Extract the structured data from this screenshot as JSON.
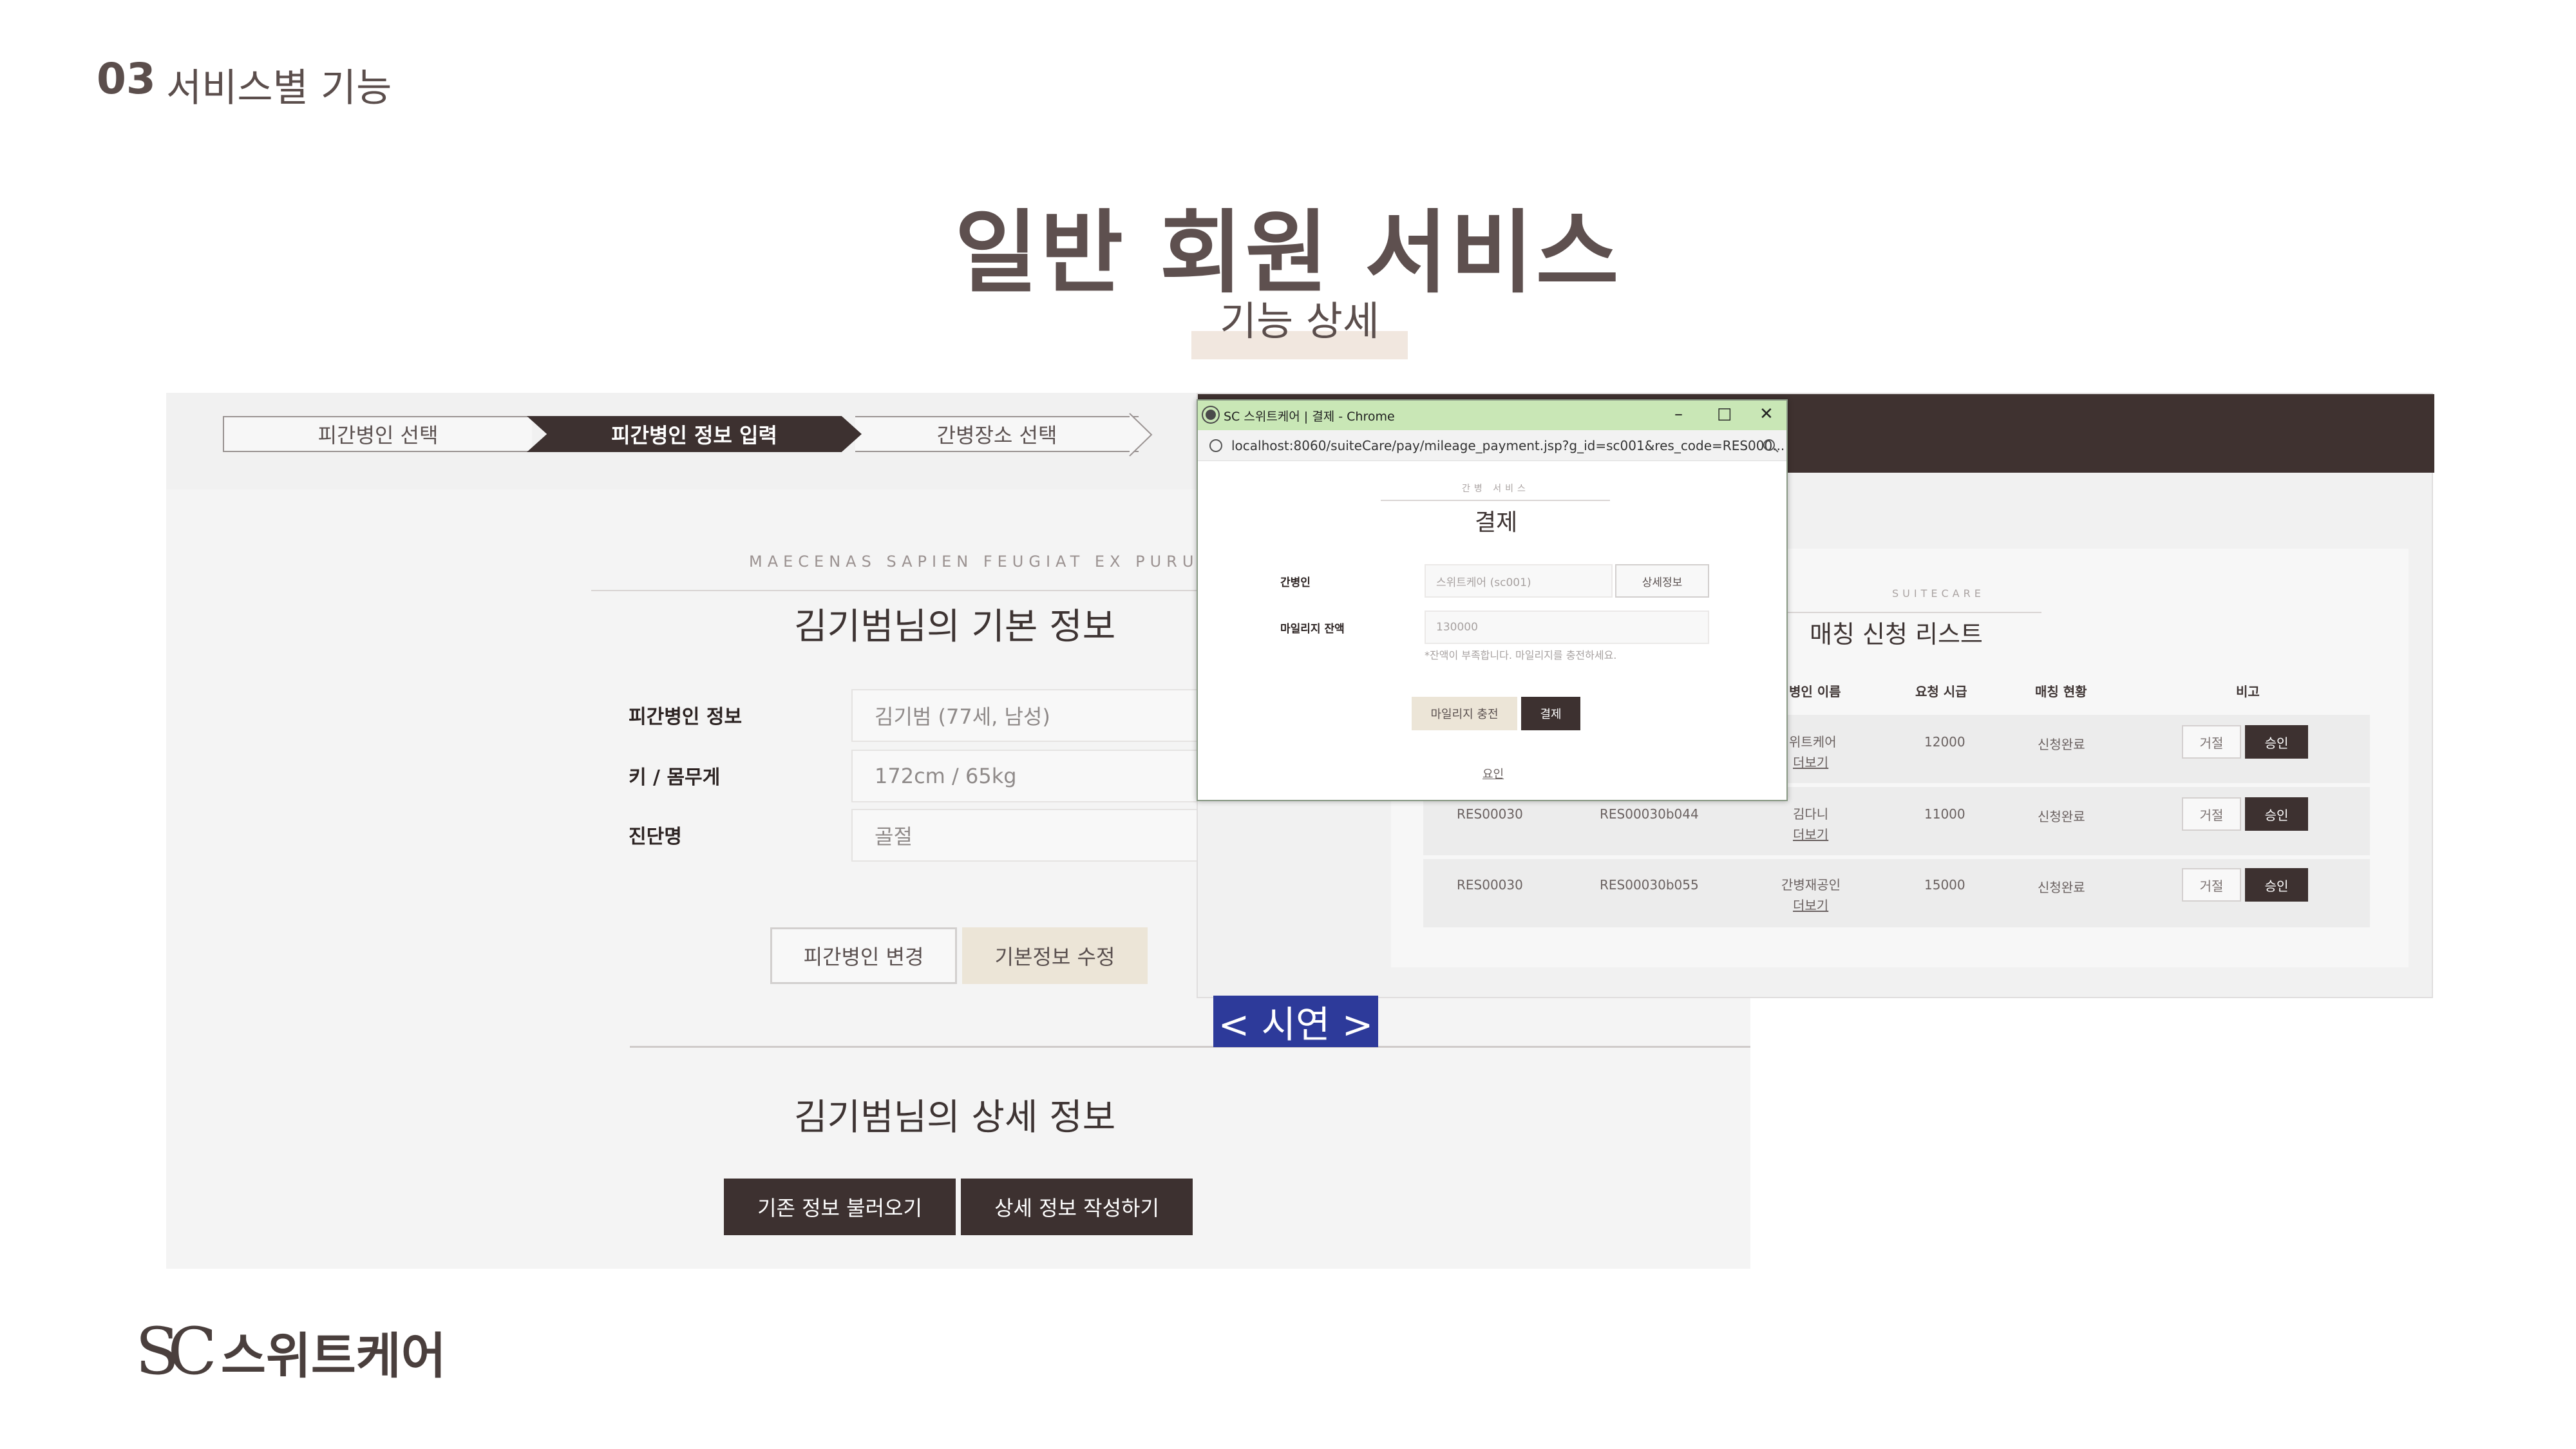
{
  "header": {
    "section_number": "03",
    "section_title": "서비스별 기능",
    "main_title": "일반 회원 서비스",
    "sub_title": "기능 상세"
  },
  "left_screen": {
    "steps": [
      "피간병인 선택",
      "피간병인 정보 입력",
      "간병장소 선택"
    ],
    "kicker": "MAECENAS SAPIEN FEUGIAT EX PURUS",
    "heading": "김기범님의 기본 정보",
    "fields": [
      {
        "label": "피간병인 정보",
        "value": "김기범 (77세, 남성)"
      },
      {
        "label": "키 / 몸무게",
        "value": "172cm / 65kg"
      },
      {
        "label": "진단명",
        "value": "골절"
      }
    ],
    "buttons": {
      "change_patient": "피간병인 변경",
      "edit_basic": "기본정보 수정"
    },
    "heading2": "김기범님의 상세 정보",
    "buttons2": {
      "load_existing": "기존 정보 불러오기",
      "write_detail": "상세 정보 작성하기"
    }
  },
  "right_screen": {
    "kicker": "SUITECARE",
    "heading": "매칭 신청 리스트",
    "columns": [
      "병인 이름",
      "요청 시급",
      "매칭 현황",
      "비고"
    ],
    "rows": [
      {
        "res_id": "",
        "res_code": "",
        "name": "위트케어",
        "more": "더보기",
        "wage": "12000",
        "status": "신청완료",
        "reject": "거절",
        "approve": "승인"
      },
      {
        "res_id": "RES00030",
        "res_code": "RES00030b044",
        "name": "김다니",
        "more": "더보기",
        "wage": "11000",
        "status": "신청완료",
        "reject": "거절",
        "approve": "승인"
      },
      {
        "res_id": "RES00030",
        "res_code": "RES00030b055",
        "name": "간병재공인",
        "more": "더보기",
        "wage": "15000",
        "status": "신청완료",
        "reject": "거절",
        "approve": "승인"
      }
    ]
  },
  "popup": {
    "window_title": "SC 스위트케어 | 결제 - Chrome",
    "url": "localhost:8060/suiteCare/pay/mileage_payment.jsp?g_id=sc001&res_code=RES000...",
    "kicker": "간병 서비스",
    "heading": "결제",
    "caregiver_label": "간병인",
    "caregiver_value": "스위트케어 (sc001)",
    "detail_button": "상세정보",
    "mileage_label": "마일리지 잔액",
    "mileage_value": "130000",
    "note": "*잔액이 부족합니다. 마일리지를 충전하세요.",
    "charge_button": "마일리지 충전",
    "pay_button": "결제",
    "link": "요인"
  },
  "demo_badge": "< 시연 >",
  "logo": {
    "mark": "SC",
    "text": "스위트케어"
  }
}
